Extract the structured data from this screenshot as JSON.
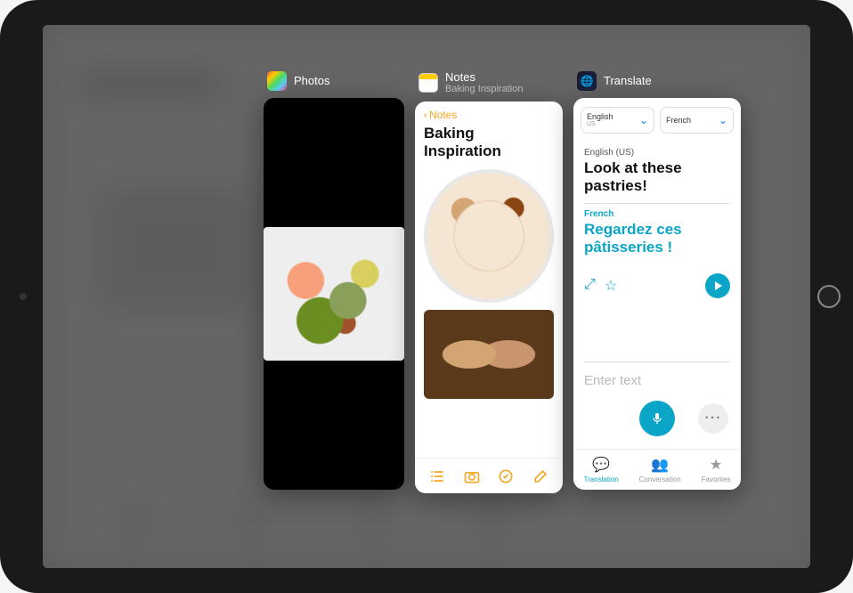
{
  "apps": {
    "photos": {
      "name": "Photos"
    },
    "notes": {
      "name": "Notes",
      "subtitle": "Baking Inspiration",
      "back_label": "Notes",
      "title": "Baking Inspiration"
    },
    "translate": {
      "name": "Translate",
      "source_lang": {
        "name": "English",
        "sub": "US"
      },
      "target_lang": {
        "name": "French"
      },
      "source_lang_full": "English (US)",
      "source_text": "Look at these pastries!",
      "target_lang_label": "French",
      "target_text": "Regardez ces pâtisseries !",
      "input_placeholder": "Enter text",
      "tabs": {
        "translation": "Translation",
        "conversation": "Conversation",
        "favorites": "Favorites"
      }
    }
  }
}
